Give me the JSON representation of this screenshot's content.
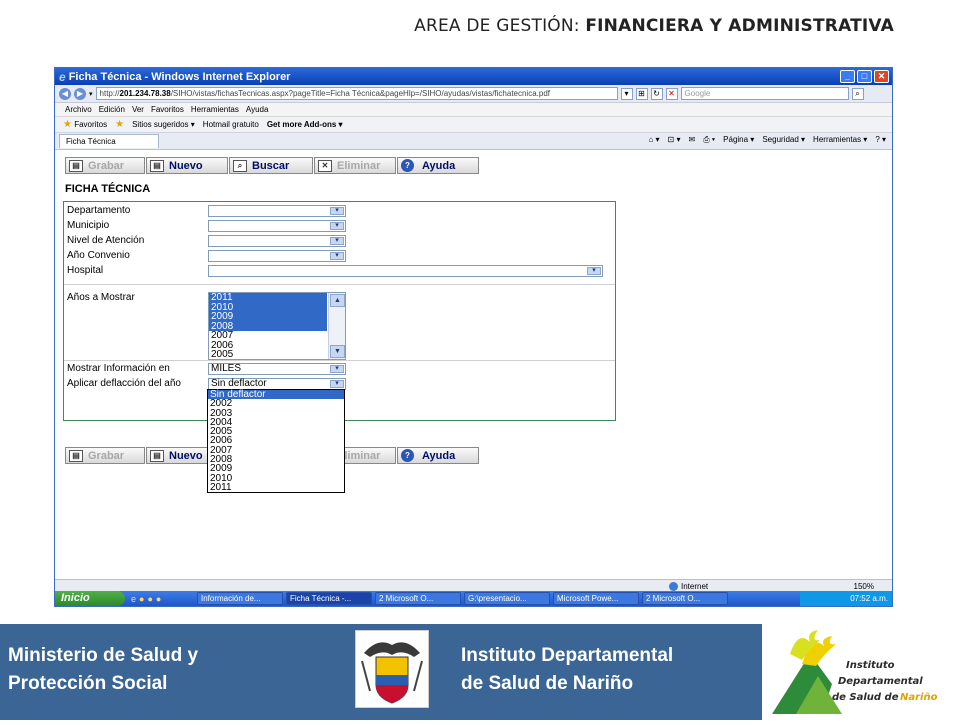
{
  "slide": {
    "header_prefix": "AREA DE GESTIÓN: ",
    "header_bold": "FINANCIERA Y ADMINISTRATIVA"
  },
  "window": {
    "title": "Ficha Técnica - Windows Internet Explorer",
    "url_prefix": "http://",
    "url_host": "201.234.78.38",
    "url_rest": "/SIHO/vistas/fichasTecnicas.aspx?pageTitle=Ficha Técnica&pageHlp=/SIHO/ayudas/vistas/fichatecnica.pdf",
    "search_placeholder": "Google",
    "menu": [
      "Archivo",
      "Edición",
      "Ver",
      "Favoritos",
      "Herramientas",
      "Ayuda"
    ],
    "favorites": [
      "Favoritos",
      "Sitios sugeridos ▾",
      "Hotmail gratuito",
      "Get more Add-ons ▾"
    ],
    "tab_label": "Ficha Técnica",
    "tools": [
      "Página ▾",
      "Seguridad ▾",
      "Herramientas ▾"
    ]
  },
  "toolbar": {
    "grabar": "Grabar",
    "nuevo": "Nuevo",
    "buscar": "Buscar",
    "eliminar": "Eliminar",
    "ayuda": "Ayuda"
  },
  "form": {
    "title": "FICHA TÉCNICA",
    "labels": {
      "departamento": "Departamento",
      "municipio": "Municipio",
      "nivel": "Nivel de Atención",
      "anio_convenio": "Año Convenio",
      "hospital": "Hospital",
      "anios_mostrar": "Años a Mostrar",
      "mostrar_info": "Mostrar Información en",
      "deflaccion": "Aplicar deflacción del año"
    },
    "years_list": [
      {
        "label": "2011",
        "selected": true
      },
      {
        "label": "2010",
        "selected": true
      },
      {
        "label": "2009",
        "selected": true
      },
      {
        "label": "2008",
        "selected": true
      },
      {
        "label": "2007",
        "selected": false
      },
      {
        "label": "2006",
        "selected": false
      },
      {
        "label": "2005",
        "selected": false
      }
    ],
    "mostrar_value": "MILES",
    "deflaccion_value": "Sin deflactor",
    "deflaccion_options": [
      "Sin deflactor",
      "2002",
      "2003",
      "2004",
      "2005",
      "2006",
      "2007",
      "2008",
      "2009",
      "2010",
      "2011"
    ]
  },
  "status": {
    "zone": "Internet",
    "zoom": "150%"
  },
  "taskbar": {
    "start": "Inicio",
    "tasks": [
      "Información de...",
      "Ficha Técnica -...",
      "2 Microsoft O...",
      "G:\\presentacio...",
      "Microsoft Powe...",
      "2 Microsoft O..."
    ],
    "clock": "07:52 a.m."
  },
  "footer": {
    "ministry_line1": "Ministerio de Salud y",
    "ministry_line2": "Protección Social",
    "instituto_line1": "Instituto Departamental",
    "instituto_line2": "de Salud de Nariño",
    "logo_text_1": "Instituto",
    "logo_text_2": "Departamental",
    "logo_text_3": "de Salud de",
    "logo_text_4": "Nariño"
  }
}
